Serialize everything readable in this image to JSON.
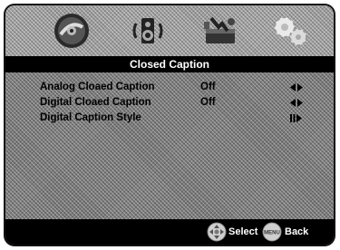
{
  "screen": {
    "title": "Closed Caption",
    "tabs": [
      {
        "icon": "disc-picture-icon"
      },
      {
        "icon": "speaker-audio-icon"
      },
      {
        "icon": "setup-toolbox-icon"
      },
      {
        "icon": "preferences-gears-icon"
      }
    ]
  },
  "menu": {
    "items": [
      {
        "label": "Analog Cloaed Caption",
        "value": "Off",
        "arrow": "left-right-arrows-icon"
      },
      {
        "label": "Digital Cloaed Caption",
        "value": "Off",
        "arrow": "left-right-arrows-icon"
      },
      {
        "label": "Digital Caption Style",
        "value": "",
        "arrow": "pause-play-arrow-icon"
      }
    ]
  },
  "footer": {
    "select_label": "Select",
    "button_label": "MENU",
    "back_label": "Back"
  },
  "colors": {
    "title_bar": "#000000",
    "frame_gray": "#7a7a7a"
  }
}
